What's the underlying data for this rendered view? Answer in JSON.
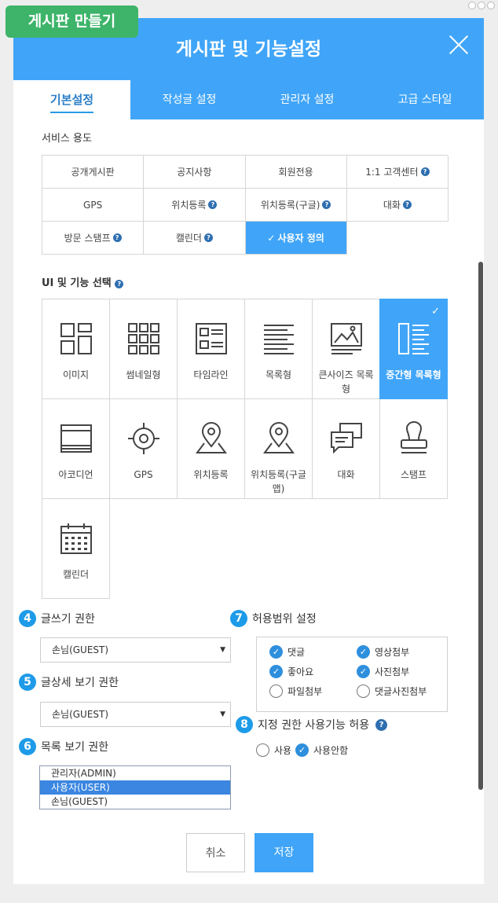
{
  "badge": {
    "label": "게시판 만들기"
  },
  "header": {
    "title": "게시판 및 기능설정"
  },
  "tabs": [
    {
      "label": "기본설정"
    },
    {
      "label": "작성글 설정"
    },
    {
      "label": "관리자 설정"
    },
    {
      "label": "고급 스타일"
    }
  ],
  "service": {
    "label": "서비스 용도",
    "items": [
      {
        "label": "공개게시판",
        "help": false,
        "selected": false
      },
      {
        "label": "공지사항",
        "help": false,
        "selected": false
      },
      {
        "label": "회원전용",
        "help": false,
        "selected": false
      },
      {
        "label": "1:1 고객센터",
        "help": true,
        "selected": false
      },
      {
        "label": "GPS",
        "help": false,
        "selected": false
      },
      {
        "label": "위치등록",
        "help": true,
        "selected": false
      },
      {
        "label": "위치등록(구글)",
        "help": true,
        "selected": false
      },
      {
        "label": "대화",
        "help": true,
        "selected": false
      },
      {
        "label": "방문 스탬프",
        "help": true,
        "selected": false
      },
      {
        "label": "캘린더",
        "help": true,
        "selected": false
      },
      {
        "label": "사용자 정의",
        "help": false,
        "selected": true
      }
    ]
  },
  "ui": {
    "label": "UI 및 기능 선택",
    "items": [
      {
        "label": "이미지",
        "icon": "image-grid-icon",
        "selected": false
      },
      {
        "label": "썸네일형",
        "icon": "thumbnail-grid-icon",
        "selected": false
      },
      {
        "label": "타임라인",
        "icon": "timeline-icon",
        "selected": false
      },
      {
        "label": "목록형",
        "icon": "list-icon",
        "selected": false
      },
      {
        "label": "큰사이즈 목록형",
        "icon": "large-list-icon",
        "selected": false
      },
      {
        "label": "중간형 목록형",
        "icon": "medium-list-icon",
        "selected": true
      },
      {
        "label": "아코디언",
        "icon": "accordion-icon",
        "selected": false
      },
      {
        "label": "GPS",
        "icon": "gps-icon",
        "selected": false
      },
      {
        "label": "위치등록",
        "icon": "location-pin-icon",
        "selected": false
      },
      {
        "label": "위치등록(구글맵)",
        "icon": "google-map-pin-icon",
        "selected": false
      },
      {
        "label": "대화",
        "icon": "chat-icon",
        "selected": false
      },
      {
        "label": "스탬프",
        "icon": "stamp-icon",
        "selected": false
      },
      {
        "label": "캘린더",
        "icon": "calendar-icon",
        "selected": false
      }
    ]
  },
  "write_perm": {
    "num": "4",
    "label": "글쓰기 권한",
    "value": "손님(GUEST)"
  },
  "detail_perm": {
    "num": "5",
    "label": "글상세 보기 권한",
    "value": "손님(GUEST)"
  },
  "list_perm": {
    "num": "6",
    "label": "목록 보기 권한",
    "options": [
      {
        "label": "관리자(ADMIN)",
        "selected": false
      },
      {
        "label": "사용자(USER)",
        "selected": true
      },
      {
        "label": "손님(GUEST)",
        "selected": false
      }
    ]
  },
  "scope": {
    "num": "7",
    "label": "허용범위 설정",
    "items": [
      {
        "label": "댓글",
        "checked": true
      },
      {
        "label": "영상첨부",
        "checked": true
      },
      {
        "label": "좋아요",
        "checked": true
      },
      {
        "label": "사진첨부",
        "checked": true
      },
      {
        "label": "파일첨부",
        "checked": false
      },
      {
        "label": "댓글사진첨부",
        "checked": false
      }
    ]
  },
  "designated": {
    "num": "8",
    "label": "지정 권한 사용기능 허용",
    "options": [
      {
        "label": "사용",
        "checked": false
      },
      {
        "label": "사용안함",
        "checked": true
      }
    ]
  },
  "buttons": {
    "cancel": "취소",
    "save": "저장"
  },
  "colors": {
    "primary": "#40a5f8",
    "badge": "#3db469",
    "number": "#1e9be8"
  }
}
